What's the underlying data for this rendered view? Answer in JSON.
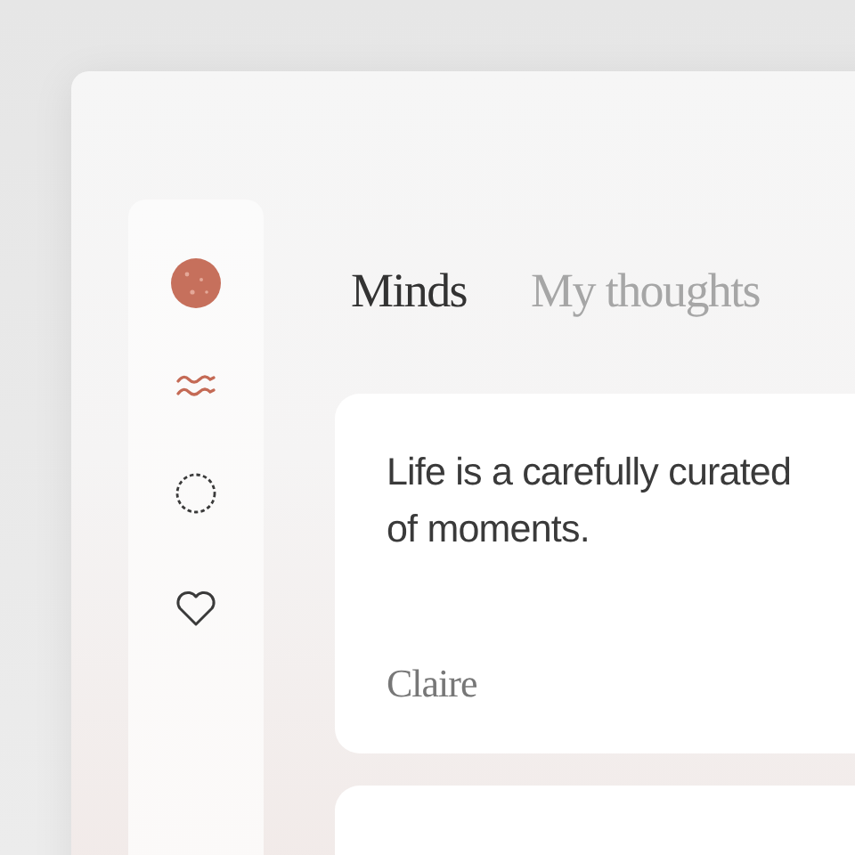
{
  "nav": [
    {
      "kind": "waves",
      "selected": true
    },
    {
      "kind": "circle",
      "selected": false
    },
    {
      "kind": "heart",
      "selected": false
    }
  ],
  "tabs": [
    {
      "label": "Minds",
      "selected": true
    },
    {
      "label": "My thoughts",
      "selected": false
    }
  ],
  "cards": [
    {
      "quote_lines": [
        "Life is a carefully curated",
        "of moments."
      ],
      "author": "Claire"
    }
  ]
}
